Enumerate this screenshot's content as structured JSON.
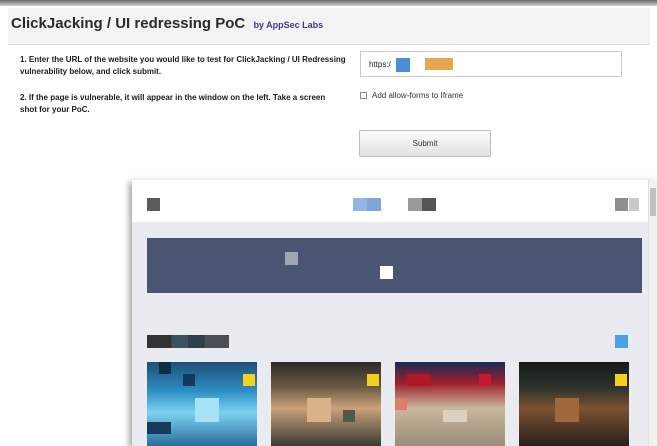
{
  "header": {
    "title": "ClickJacking / UI redressing PoC",
    "byline": "by AppSec Labs"
  },
  "instructions": {
    "step1": "1. Enter the URL of the website you would like to test for ClickJacking / UI Redressing vulnerability below, and click submit.",
    "step2": "2. If the page is vulnerable, it will appear in the window on the left. Take a screen shot for your PoC."
  },
  "form": {
    "url_value": "https:/",
    "allow_forms_label": "Add allow-forms to Iframe",
    "allow_forms_checked": false,
    "submit_label": "Submit"
  },
  "colors": {
    "banner": "#4b5571",
    "redaction_blue": "#4a90d9",
    "redaction_orange": "#e8a64c"
  }
}
